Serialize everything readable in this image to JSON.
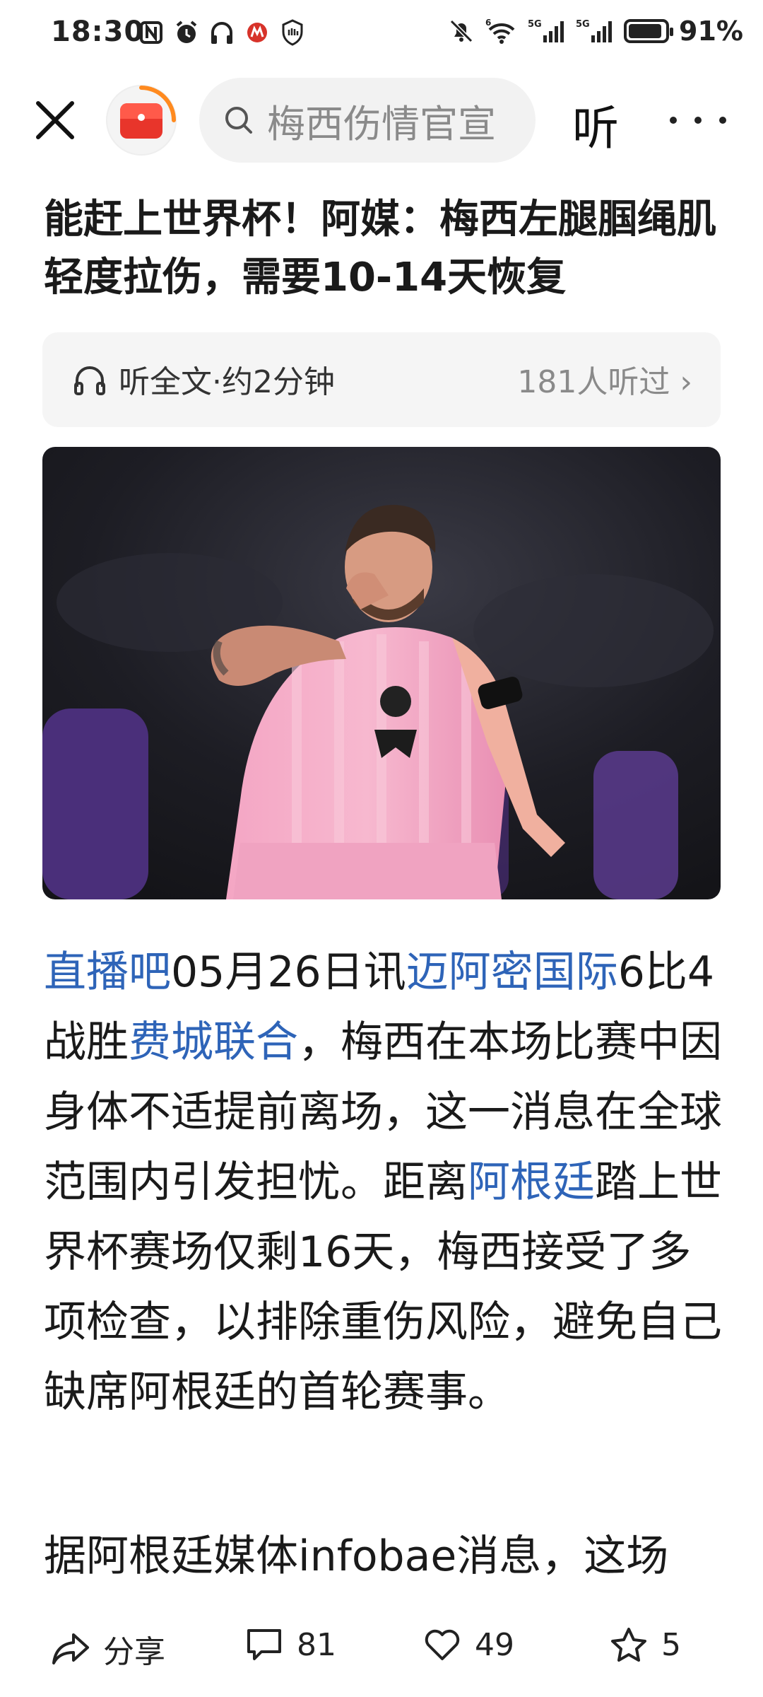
{
  "status_bar": {
    "time": "18:30",
    "network_5g": "5G",
    "network_6g": "6",
    "battery_percent": "91%",
    "battery_level": 0.91
  },
  "nav": {
    "search_placeholder": "梅西伤情官宣",
    "listen_label": "听"
  },
  "article": {
    "headline": "能赶上世界杯！阿媒：梅西左腿腘绳肌轻度拉伤，需要10-14天恢复",
    "listen": {
      "label": "听全文·约2分钟",
      "count": "181人听过 ›"
    },
    "body_segments": [
      {
        "text": "直播吧",
        "link": true
      },
      {
        "text": "05月26日讯",
        "link": false
      },
      {
        "text": "迈阿密国际",
        "link": true
      },
      {
        "text": "6比4战胜",
        "link": false
      },
      {
        "text": "费城联合",
        "link": true
      },
      {
        "text": "，梅西在本场比赛中因身体不适提前离场，这一消息在全球范围内引发担忧。距离",
        "link": false
      },
      {
        "text": "阿根廷",
        "link": true
      },
      {
        "text": "踏上世界杯赛场仅剩16天，梅西接受了多项检查，以排除重伤风险，避免自己缺席阿根廷的首轮赛事。",
        "link": false
      }
    ],
    "body_second": "据阿根廷媒体infobae消息，这场"
  },
  "actions": {
    "share_label": "分享",
    "comment_count": "81",
    "like_count": "49",
    "favorite_count": "5"
  },
  "colors": {
    "link": "#2e64b8",
    "avatar_red": "#e8352b",
    "ring_orange": "#ff8a1f"
  }
}
